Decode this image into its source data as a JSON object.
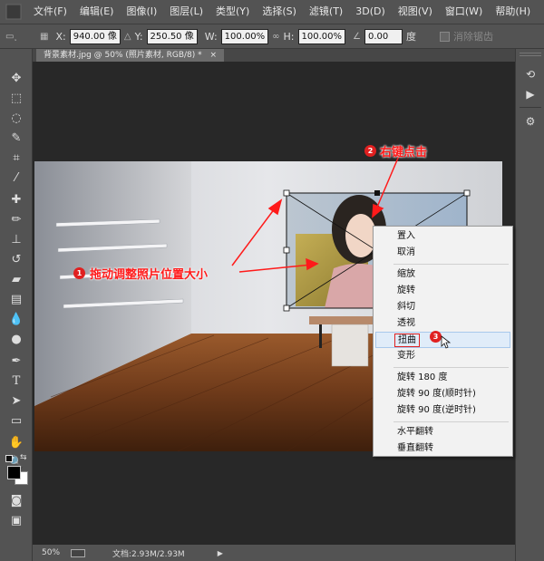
{
  "menubar": {
    "items": [
      "文件(F)",
      "编辑(E)",
      "图像(I)",
      "图层(L)",
      "类型(Y)",
      "选择(S)",
      "滤镜(T)",
      "3D(D)",
      "视图(V)",
      "窗口(W)",
      "帮助(H)"
    ]
  },
  "options": {
    "x_label": "X:",
    "x_value": "940.00 像",
    "y_label": "Y:",
    "y_value": "250.50 像",
    "w_label": "W:",
    "w_value": "100.00%",
    "h_label": "H:",
    "h_value": "100.00%",
    "angle_value": "0.00",
    "angle_unit": "度",
    "antialias_label": "消除锯齿"
  },
  "document_tab": {
    "label": "背景素材.jpg @ 50% (照片素材, RGB/8) *",
    "close": "×"
  },
  "status": {
    "zoom": "50%",
    "doc_info": "文档:2.93M/2.93M"
  },
  "context_menu": {
    "items": [
      "置入",
      "取消",
      "缩放",
      "旋转",
      "斜切",
      "透视",
      "扭曲",
      "变形",
      "旋转 180 度",
      "旋转 90 度(顺时针)",
      "旋转 90 度(逆时针)",
      "水平翻转",
      "垂直翻转"
    ],
    "highlighted": "扭曲"
  },
  "annotations": {
    "step1_num": "1",
    "step1_text": "拖动调整照片位置大小",
    "step2_num": "2",
    "step2_text": "右键点击",
    "step3_num": "3"
  },
  "colors": {
    "annotation_red": "#ff1a1a",
    "badge_red": "#e02020",
    "highlight": "#e0ecf9"
  }
}
